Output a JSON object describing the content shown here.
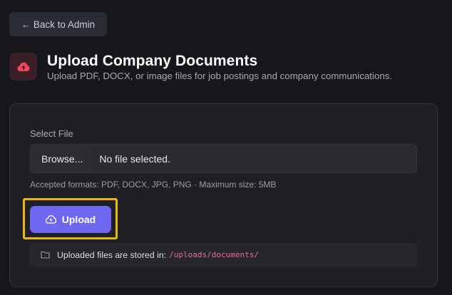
{
  "nav": {
    "back_label": "Back to Admin",
    "back_icon": "arrow-left-icon"
  },
  "header": {
    "icon": "cloud-upload-icon",
    "title": "Upload Company Documents",
    "subtitle": "Upload PDF, DOCX, or image files for job postings and company communications."
  },
  "form": {
    "file_label": "Select File",
    "browse_label": "Browse...",
    "file_status": "No file selected.",
    "help_text": "Accepted formats: PDF, DOCX, JPG, PNG · Maximum size: 5MB",
    "upload_label": "Upload",
    "upload_icon": "cloud-upload-icon"
  },
  "storage": {
    "icon": "folder-icon",
    "text": "Uploaded files are stored in:",
    "path": "/uploads/documents/"
  },
  "colors": {
    "accent": "#6f66f2",
    "focus_ring": "#e8b80f",
    "path_text": "#ec6b9a",
    "icon_red": "#f0465f"
  }
}
